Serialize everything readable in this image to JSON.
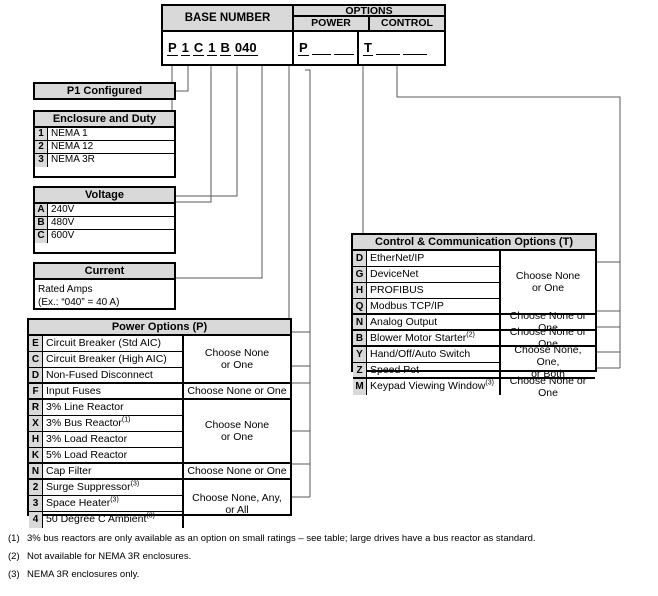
{
  "code_block": {
    "base_number_title": "BASE NUMBER",
    "options_title": "OPTIONS",
    "power_title": "POWER",
    "control_title": "CONTROL",
    "base_chars": [
      "P",
      "1",
      "C",
      "1",
      "B",
      "040"
    ],
    "power_prefix": "P",
    "control_prefix": "T"
  },
  "p1_configured": {
    "title": "P1 Configured"
  },
  "enclosure": {
    "title": "Enclosure and Duty",
    "rows": [
      {
        "code": "1",
        "label": "NEMA 1"
      },
      {
        "code": "2",
        "label": "NEMA 12"
      },
      {
        "code": "3",
        "label": "NEMA 3R"
      }
    ]
  },
  "voltage": {
    "title": "Voltage",
    "rows": [
      {
        "code": "A",
        "label": "240V"
      },
      {
        "code": "B",
        "label": "480V"
      },
      {
        "code": "C",
        "label": "600V"
      }
    ]
  },
  "current": {
    "title": "Current",
    "line1": "Rated Amps",
    "line2": "(Ex.: “040” = 40 A)"
  },
  "power_options": {
    "title": "Power Options (P)",
    "groups": [
      {
        "rule": "Choose None or One",
        "rule_lines": [
          "Choose None",
          "or One"
        ],
        "rows": [
          {
            "code": "E",
            "label": "Circuit Breaker (Std AIC)",
            "note": ""
          },
          {
            "code": "C",
            "label": "Circuit Breaker (High AIC)",
            "note": ""
          },
          {
            "code": "D",
            "label": "Non-Fused Disconnect",
            "note": ""
          }
        ]
      },
      {
        "rule": "Choose None or One",
        "rule_lines": [
          "Choose None or One"
        ],
        "rows": [
          {
            "code": "F",
            "label": "Input Fuses",
            "note": ""
          }
        ]
      },
      {
        "rule": "Choose None or One",
        "rule_lines": [
          "Choose None",
          "or One"
        ],
        "rows": [
          {
            "code": "R",
            "label": "3% Line Reactor",
            "note": ""
          },
          {
            "code": "X",
            "label": "3% Bus Reactor",
            "note": "(1)"
          },
          {
            "code": "H",
            "label": "3% Load Reactor",
            "note": ""
          },
          {
            "code": "K",
            "label": "5% Load Reactor",
            "note": ""
          }
        ]
      },
      {
        "rule": "Choose None or One",
        "rule_lines": [
          "Choose None or One"
        ],
        "rows": [
          {
            "code": "N",
            "label": "Cap Filter",
            "note": ""
          }
        ]
      },
      {
        "rule": "Choose None, Any, or All",
        "rule_lines": [
          "Choose None, Any,",
          "or All"
        ],
        "rows": [
          {
            "code": "2",
            "label": "Surge Suppressor",
            "note": "(3)"
          },
          {
            "code": "3",
            "label": "Space Heater",
            "note": "(3)"
          },
          {
            "code": "4",
            "label": "50 Degree C Ambient",
            "note": "(3)"
          }
        ]
      }
    ]
  },
  "control_options": {
    "title": "Control & Communication Options (T)",
    "groups": [
      {
        "rule": "Choose None or One",
        "rule_lines": [
          "Choose None",
          "or One"
        ],
        "rows": [
          {
            "code": "D",
            "label": "EtherNet/IP",
            "note": ""
          },
          {
            "code": "G",
            "label": "DeviceNet",
            "note": ""
          },
          {
            "code": "H",
            "label": "PROFIBUS",
            "note": ""
          },
          {
            "code": "Q",
            "label": "Modbus TCP/IP",
            "note": ""
          }
        ]
      },
      {
        "rule": "Choose None or One",
        "rule_lines": [
          "Choose None or One"
        ],
        "rows": [
          {
            "code": "N",
            "label": "Analog Output",
            "note": ""
          }
        ]
      },
      {
        "rule": "Choose None or One",
        "rule_lines": [
          "Choose None or One"
        ],
        "rows": [
          {
            "code": "B",
            "label": "Blower Motor Starter",
            "note": "(2)"
          }
        ]
      },
      {
        "rule": "Choose None, One, or Both",
        "rule_lines": [
          "Choose None, One,",
          "or Both"
        ],
        "rows": [
          {
            "code": "Y",
            "label": "Hand/Off/Auto Switch",
            "note": ""
          },
          {
            "code": "Z",
            "label": "Speed Pot",
            "note": ""
          }
        ]
      },
      {
        "rule": "Choose None or One",
        "rule_lines": [
          "Choose None or One"
        ],
        "rows": [
          {
            "code": "M",
            "label": "Keypad Viewing Window",
            "note": "(3)"
          }
        ]
      }
    ]
  },
  "footnotes": [
    {
      "num": "(1)",
      "text": "3% bus reactors are only available as an option on small ratings – see table; large drives have a bus reactor as standard."
    },
    {
      "num": "(2)",
      "text": "Not available for NEMA 3R enclosures."
    },
    {
      "num": "(3)",
      "text": "NEMA 3R enclosures only."
    }
  ],
  "colors": {
    "header_fill": "#d9d9d9",
    "line": "#000000",
    "wire": "#58585a"
  }
}
